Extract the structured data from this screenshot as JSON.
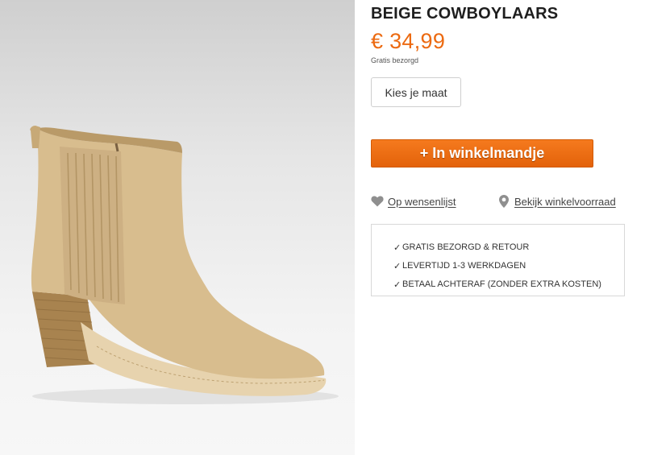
{
  "product": {
    "title": "BEIGE COWBOYLAARS",
    "price": "€ 34,99",
    "shipping_note": "Gratis bezorgd",
    "image_alt": "beige suede ankle boot",
    "colors": {
      "price": "#ec6a11",
      "cart_button": "#ee6f15",
      "boot": "#d8bd8e"
    }
  },
  "actions": {
    "size_label": "Kies je maat",
    "cart_label": "+ In winkelmandje",
    "wishlist_label": "Op wensenlijst",
    "wishlist_icon": "heart-icon",
    "store_label": "Bekijk winkelvoorraad",
    "store_icon": "map-pin-icon"
  },
  "usps": [
    {
      "check": "✓",
      "text": "GRATIS BEZORGD & RETOUR"
    },
    {
      "check": "✓",
      "text": "LEVERTIJD 1-3 WERKDAGEN"
    },
    {
      "check": "✓",
      "text": "BETAAL ACHTERAF (ZONDER EXTRA KOSTEN)"
    }
  ]
}
